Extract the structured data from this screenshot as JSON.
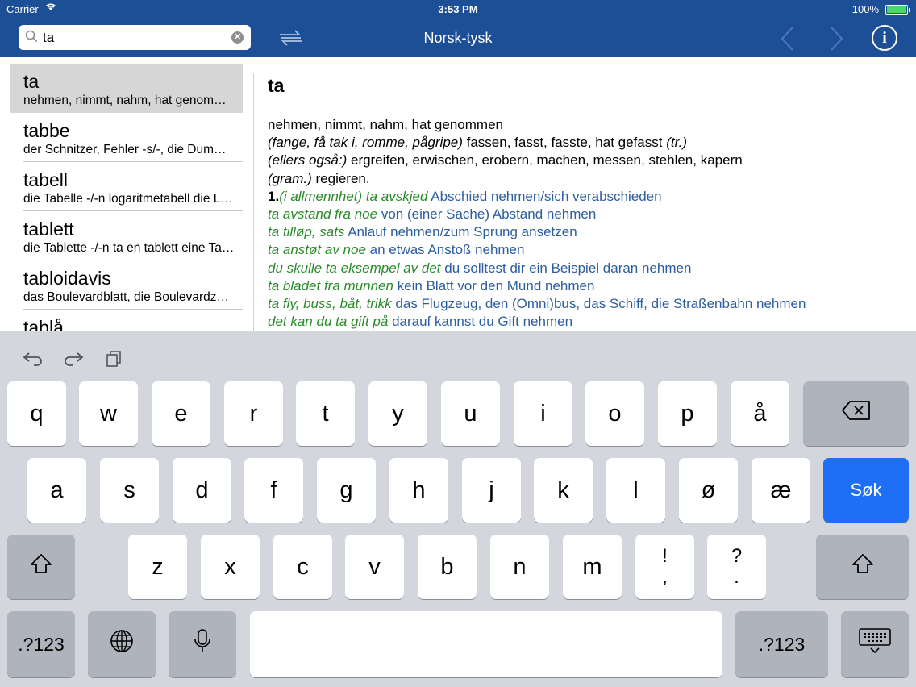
{
  "status_bar": {
    "carrier": "Carrier",
    "time": "3:53 PM",
    "battery": "100%"
  },
  "nav": {
    "search_value": "ta",
    "title": "Norsk-tysk",
    "info_label": "i"
  },
  "word_list": [
    {
      "headword": "ta",
      "translation": "nehmen, nimmt, nahm, hat genommen",
      "selected": true
    },
    {
      "headword": "tabbe",
      "translation": "der Schnitzer, Fehler -s/-, die Dummheit",
      "selected": false
    },
    {
      "headword": "tabell",
      "translation": "die Tabelle -/-n logaritmetabell die Logarithmentafel",
      "selected": false
    },
    {
      "headword": "tablett",
      "translation": "die Tablette -/-n ta en tablett eine Tablette nehmen",
      "selected": false
    },
    {
      "headword": "tabloidavis",
      "translation": "das Boulevardblatt, die Boulevardzeitung",
      "selected": false
    },
    {
      "headword": "tablå",
      "translation": "",
      "selected": false
    }
  ],
  "entry": {
    "headword": "ta",
    "lines": [
      [
        {
          "t": "nehmen, nimmt, nahm, hat genommen",
          "c": ""
        }
      ],
      [
        {
          "t": "(fange, få tak i, romme, pågripe)",
          "c": "it"
        },
        {
          "t": " fassen, fasst, fasste, hat gefasst ",
          "c": ""
        },
        {
          "t": "(tr.)",
          "c": "it"
        }
      ],
      [
        {
          "t": "(ellers også:)",
          "c": "it"
        },
        {
          "t": " ergreifen, erwischen, erobern, machen, messen, stehlen, kapern",
          "c": ""
        }
      ],
      [
        {
          "t": "(gram.)",
          "c": "it"
        },
        {
          "t": " regieren.",
          "c": ""
        }
      ],
      [
        {
          "t": "1.",
          "c": "bold"
        },
        {
          "t": "(i allmennhet) ta avskjed",
          "c": "g"
        },
        {
          "t": " Abschied nehmen/sich verabschieden",
          "c": "b"
        }
      ],
      [
        {
          "t": "ta avstand fra noe",
          "c": "g"
        },
        {
          "t": " von (einer Sache) Abstand nehmen",
          "c": "b"
        }
      ],
      [
        {
          "t": "ta tilløp, sats",
          "c": "g"
        },
        {
          "t": " Anlauf nehmen/zum Sprung ansetzen",
          "c": "b"
        }
      ],
      [
        {
          "t": "ta anstøt av noe",
          "c": "g"
        },
        {
          "t": " an etwas Anstoß nehmen",
          "c": "b"
        }
      ],
      [
        {
          "t": "du skulle ta eksempel av det",
          "c": "g"
        },
        {
          "t": " du solltest dir ein Beispiel daran nehmen",
          "c": "b"
        }
      ],
      [
        {
          "t": "ta bladet fra munnen",
          "c": "g"
        },
        {
          "t": " kein Blatt vor den Mund nehmen",
          "c": "b"
        }
      ],
      [
        {
          "t": "ta fly, buss, båt, trikk",
          "c": "g"
        },
        {
          "t": " das Flugzeug, den (Omni)bus, das Schiff, die Straßenbahn nehmen",
          "c": "b"
        }
      ],
      [
        {
          "t": "det kan du ta gift på",
          "c": "g"
        },
        {
          "t": " darauf kannst du Gift nehmen",
          "c": "b"
        }
      ]
    ]
  },
  "keyboard": {
    "row1": [
      "q",
      "w",
      "e",
      "r",
      "t",
      "y",
      "u",
      "i",
      "o",
      "p",
      "å"
    ],
    "row2": [
      "a",
      "s",
      "d",
      "f",
      "g",
      "h",
      "j",
      "k",
      "l",
      "ø",
      "æ"
    ],
    "row3": [
      "z",
      "x",
      "c",
      "v",
      "b",
      "n",
      "m"
    ],
    "punct1_top": "!",
    "punct1_bottom": ",",
    "punct2_top": "?",
    "punct2_bottom": ".",
    "search_key": "Søk",
    "numbers_key": ".?123"
  }
}
